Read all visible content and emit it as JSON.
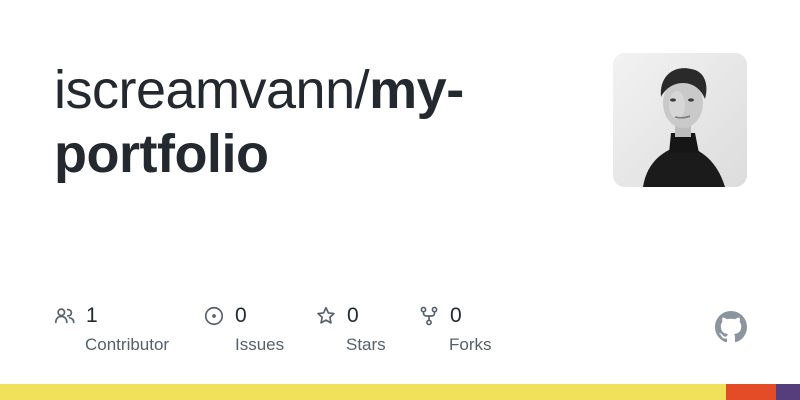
{
  "repo": {
    "owner": "iscreamvann/",
    "name": "my-portfolio"
  },
  "stats": [
    {
      "icon": "contributors-icon",
      "value": "1",
      "label": "Contributor"
    },
    {
      "icon": "issues-icon",
      "value": "0",
      "label": "Issues"
    },
    {
      "icon": "star-icon",
      "value": "0",
      "label": "Stars"
    },
    {
      "icon": "fork-icon",
      "value": "0",
      "label": "Forks"
    }
  ],
  "language_bar": [
    {
      "color": "#f1e05a"
    },
    {
      "color": "#e34c26"
    },
    {
      "color": "#563d7c"
    }
  ],
  "colors": {
    "text": "#24292f",
    "muted": "#57606a"
  }
}
